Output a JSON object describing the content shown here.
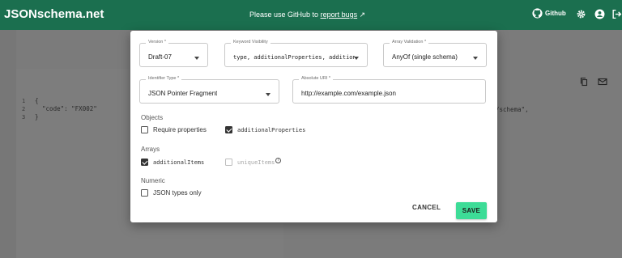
{
  "app": {
    "title": "JSONschema.net",
    "report_prefix": "Please use GitHub to",
    "report_link": "report bugs",
    "github_label": "Github"
  },
  "editor": {
    "line_numbers": [
      "1",
      "2",
      "3"
    ],
    "lines": [
      "{",
      "  \"code\": \"FX002\"",
      "}"
    ],
    "right_tail": "/schema\","
  },
  "dialog": {
    "version": {
      "label": "Version *",
      "value": "Draft-07"
    },
    "keyword_visibility": {
      "label": "Keyword Visibility",
      "value": "type, additionalProperties, addition…"
    },
    "array_validation": {
      "label": "Array Validation *",
      "value": "AnyOf (single schema)"
    },
    "identifier_type": {
      "label": "Identifier Type *",
      "value": "JSON Pointer Fragment"
    },
    "absolute_uri": {
      "label": "Absolute URI *",
      "value": "http://example.com/example.json"
    },
    "objects": {
      "heading": "Objects",
      "require_properties": {
        "label": "Require properties",
        "checked": false
      },
      "additional_properties": {
        "label": "additionalProperties",
        "checked": true
      }
    },
    "arrays": {
      "heading": "Arrays",
      "additional_items": {
        "label": "additionalItems",
        "checked": true
      },
      "unique_items": {
        "label": "uniqueItems",
        "checked": false,
        "disabled": true
      }
    },
    "numeric": {
      "heading": "Numeric",
      "json_types_only": {
        "label": "JSON types only",
        "checked": false
      }
    },
    "cancel_label": "CANCEL",
    "save_label": "SAVE"
  },
  "colors": {
    "topbar": "#1b6f4f",
    "accent": "#3ddc97"
  }
}
